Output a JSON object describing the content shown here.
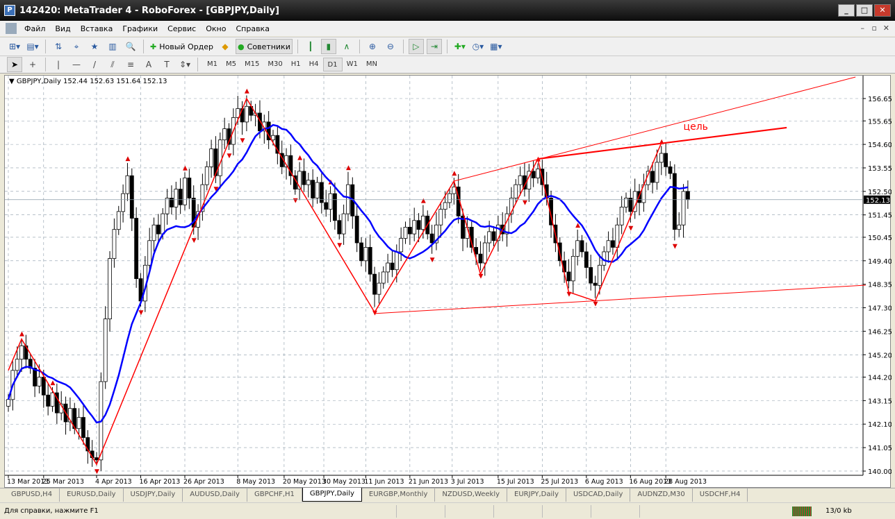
{
  "window": {
    "title": "142420: MetaTrader 4 - RoboForex - [GBPJPY,Daily]"
  },
  "menu": [
    "Файл",
    "Вид",
    "Вставка",
    "Графики",
    "Сервис",
    "Окно",
    "Справка"
  ],
  "toolbar": {
    "new_order": "Новый Ордер",
    "experts": "Советники"
  },
  "timeframes": [
    "M1",
    "M5",
    "M15",
    "M30",
    "H1",
    "H4",
    "D1",
    "W1",
    "MN"
  ],
  "active_timeframe": "D1",
  "chart_data": {
    "type": "candlestick",
    "symbol_info": "GBPJPY,Daily  152.44 152.63 151.64 152.13",
    "current_price": "152.13",
    "ylim": [
      140.0,
      157.6
    ],
    "y_ticks": [
      "156.65",
      "155.65",
      "154.60",
      "153.55",
      "152.50",
      "151.45",
      "150.45",
      "149.40",
      "148.35",
      "147.30",
      "146.25",
      "145.20",
      "144.20",
      "143.15",
      "142.10",
      "141.05",
      "140.00"
    ],
    "x_ticks": [
      {
        "label": "13 Mar 2013",
        "bar": 0
      },
      {
        "label": "25 Mar 2013",
        "bar": 8
      },
      {
        "label": "4 Apr 2013",
        "bar": 20
      },
      {
        "label": "16 Apr 2013",
        "bar": 30
      },
      {
        "label": "26 Apr 2013",
        "bar": 40
      },
      {
        "label": "8 May 2013",
        "bar": 52
      },
      {
        "label": "20 May 2013",
        "bar": 62.5
      },
      {
        "label": "30 May 2013",
        "bar": 71.5
      },
      {
        "label": "11 Jun 2013",
        "bar": 81
      },
      {
        "label": "21 Jun 2013",
        "bar": 91
      },
      {
        "label": "3 Jul 2013",
        "bar": 100.6
      },
      {
        "label": "15 Jul 2013",
        "bar": 111
      },
      {
        "label": "25 Jul 2013",
        "bar": 121
      },
      {
        "label": "6 Aug 2013",
        "bar": 131
      },
      {
        "label": "16 Aug 2013",
        "bar": 141
      },
      {
        "label": "28 Aug 2013",
        "bar": 149
      }
    ],
    "closes": [
      143.2,
      144.5,
      145.0,
      145.6,
      145.0,
      144.6,
      143.8,
      144.2,
      143.4,
      142.9,
      143.5,
      142.6,
      143.0,
      142.2,
      142.8,
      141.9,
      142.4,
      141.5,
      140.9,
      140.6,
      140.5,
      144.0,
      146.8,
      149.5,
      150.8,
      151.6,
      152.4,
      153.2,
      151.3,
      148.6,
      147.6,
      149.2,
      150.3,
      151.0,
      150.6,
      151.5,
      152.2,
      151.8,
      152.6,
      151.9,
      153.1,
      152.2,
      150.9,
      151.6,
      152.8,
      153.6,
      154.4,
      153.2,
      154.8,
      155.3,
      154.6,
      155.8,
      156.2,
      155.6,
      156.3,
      155.9,
      156.0,
      155.2,
      155.6,
      154.8,
      155.0,
      154.2,
      153.6,
      154.1,
      153.2,
      152.6,
      153.4,
      152.8,
      153.0,
      152.2,
      152.9,
      152.0,
      151.7,
      152.4,
      151.2,
      150.6,
      151.5,
      152.8,
      151.4,
      150.2,
      149.4,
      150.0,
      148.8,
      147.9,
      148.4,
      148.9,
      149.3,
      149.0,
      149.8,
      150.4,
      150.9,
      150.6,
      151.2,
      150.8,
      151.4,
      150.6,
      150.2,
      151.0,
      151.7,
      152.0,
      152.4,
      152.7,
      151.4,
      150.4,
      150.9,
      150.0,
      149.7,
      149.3,
      150.2,
      150.7,
      150.3,
      151.0,
      150.6,
      151.5,
      152.2,
      152.8,
      153.2,
      152.6,
      153.4,
      153.1,
      153.5,
      152.8,
      152.2,
      151.0,
      150.2,
      149.4,
      148.9,
      148.5,
      149.6,
      150.3,
      149.8,
      149.1,
      148.4,
      148.3,
      149.2,
      149.8,
      150.3,
      150.0,
      151.0,
      151.8,
      152.2,
      151.6,
      152.5,
      152.0,
      152.8,
      153.4,
      152.9,
      153.8,
      154.2,
      153.6,
      153.3,
      150.8,
      151.0,
      152.5,
      152.13
    ],
    "ma_period": 13,
    "zigzag": [
      [
        0,
        144.5
      ],
      [
        3,
        145.9
      ],
      [
        20,
        140.3
      ],
      [
        54,
        156.65
      ],
      [
        83,
        147.1
      ],
      [
        101,
        152.96
      ],
      [
        107,
        148.8
      ],
      [
        120,
        153.95
      ],
      [
        127,
        148.0
      ],
      [
        133,
        147.6
      ],
      [
        148,
        154.67
      ]
    ],
    "trendlines": [
      {
        "from": [
          101,
          152.96
        ],
        "to": [
          192,
          157.61
        ],
        "width": "thin"
      },
      {
        "from": [
          120,
          153.95
        ],
        "to": [
          176.4,
          155.35
        ],
        "width": "thick"
      },
      {
        "from": [
          83,
          147.04
        ],
        "to": [
          194.3,
          148.31
        ],
        "width": "thin"
      }
    ],
    "annotation": "цель",
    "colors": {
      "zigzag": "#ff0000",
      "ma": "#0000ff",
      "bull": "#ffffff",
      "bear": "#000000"
    }
  },
  "tabs": [
    "GBPUSD,H4",
    "EURUSD,Daily",
    "USDJPY,Daily",
    "AUDUSD,Daily",
    "GBPCHF,H1",
    "GBPJPY,Daily",
    "EURGBP,Monthly",
    "NZDUSD,Weekly",
    "EURJPY,Daily",
    "USDCAD,Daily",
    "AUDNZD,M30",
    "USDCHF,H4"
  ],
  "active_tab": "GBPJPY,Daily",
  "status": {
    "help": "Для справки, нажмите F1",
    "traffic": "13/0 kb"
  }
}
